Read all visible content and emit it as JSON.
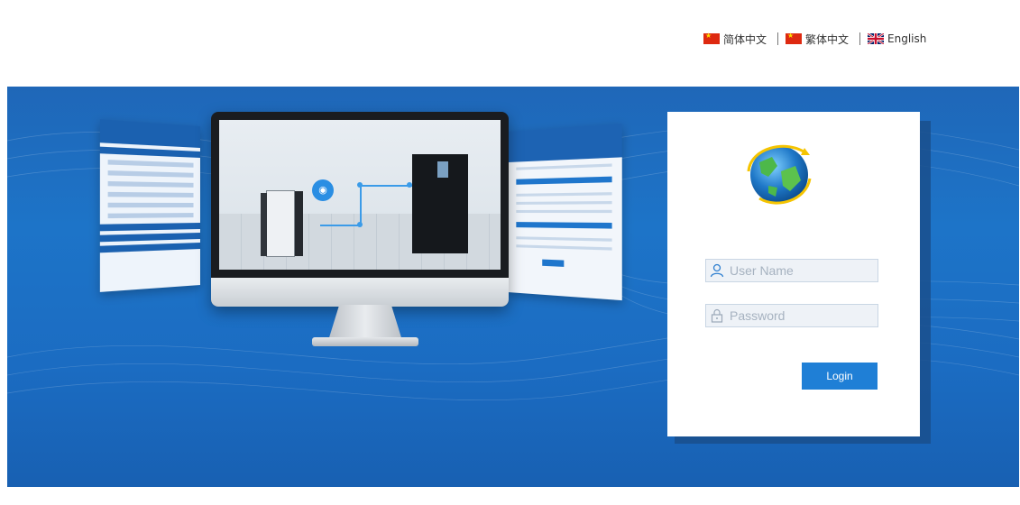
{
  "language_bar": {
    "items": [
      {
        "label": "简体中文",
        "flag": "cn-flag-icon"
      },
      {
        "label": "繁体中文",
        "flag": "cn-flag-icon"
      },
      {
        "label": "English",
        "flag": "uk-flag-icon"
      }
    ]
  },
  "login": {
    "username_placeholder": "User Name",
    "password_placeholder": "Password",
    "login_label": "Login"
  },
  "colors": {
    "banner": "#1d74c8",
    "button": "#1f7fd6",
    "card": "#ffffff"
  }
}
